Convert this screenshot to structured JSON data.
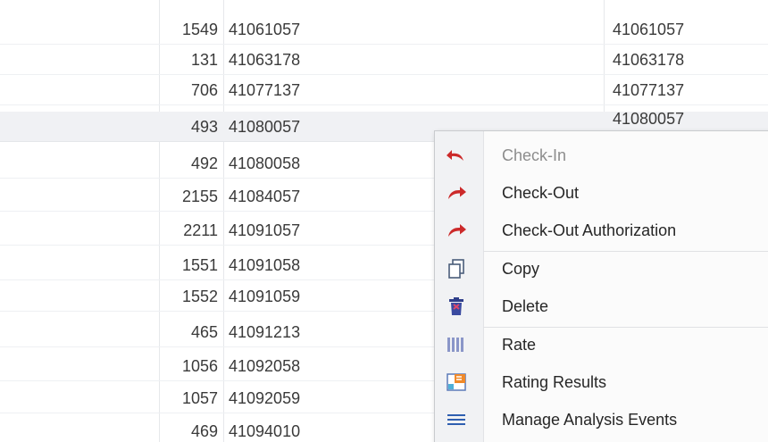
{
  "table": {
    "rows": [
      {
        "id": "1549",
        "code": "41061057",
        "code2": "41061057"
      },
      {
        "id": "131",
        "code": "41063178",
        "code2": "41063178"
      },
      {
        "id": "706",
        "code": "41077137",
        "code2": "41077137"
      },
      {
        "id": "493",
        "code": "41080057",
        "code2": "41080057"
      },
      {
        "id": "492",
        "code": "41080058",
        "code2": ""
      },
      {
        "id": "2155",
        "code": "41084057",
        "code2": ""
      },
      {
        "id": "2211",
        "code": "41091057",
        "code2": ""
      },
      {
        "id": "1551",
        "code": "41091058",
        "code2": ""
      },
      {
        "id": "1552",
        "code": "41091059",
        "code2": ""
      },
      {
        "id": "465",
        "code": "41091213",
        "code2": ""
      },
      {
        "id": "1056",
        "code": "41092058",
        "code2": ""
      },
      {
        "id": "1057",
        "code": "41092059",
        "code2": ""
      },
      {
        "id": "469",
        "code": "41094010",
        "code2": ""
      }
    ],
    "selected_row_index": 3
  },
  "context_menu": {
    "items": [
      {
        "label": "Check-In",
        "icon": "undo-arrow-icon",
        "disabled": true
      },
      {
        "label": "Check-Out",
        "icon": "redo-arrow-icon",
        "disabled": false
      },
      {
        "label": "Check-Out Authorization",
        "icon": "redo-arrow-icon",
        "disabled": false
      },
      {
        "label": "Copy",
        "icon": "copy-icon",
        "disabled": false
      },
      {
        "label": "Delete",
        "icon": "trash-icon",
        "disabled": false
      },
      {
        "label": "Rate",
        "icon": "rate-bars-icon",
        "disabled": false,
        "highlighted": true
      },
      {
        "label": "Rating Results",
        "icon": "rating-results-icon",
        "disabled": false
      },
      {
        "label": "Manage Analysis Events",
        "icon": "list-lines-icon",
        "disabled": false
      }
    ]
  },
  "colors": {
    "arrow_red": "#cc2a2a",
    "highlight_yellow": "#f6f73c",
    "menu_background": "#fbfbfb",
    "selected_row": "#f0f1f4"
  }
}
